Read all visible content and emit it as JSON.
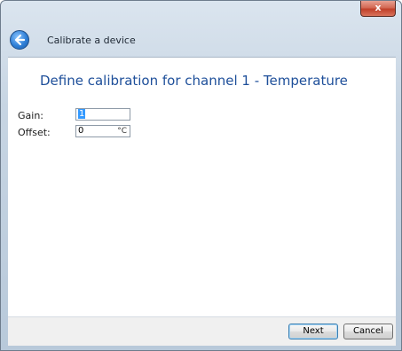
{
  "window": {
    "title": "Calibrate a device",
    "close_label": "x"
  },
  "main": {
    "heading": "Define calibration for channel 1 - Temperature",
    "fields": [
      {
        "label": "Gain:",
        "value": "1",
        "unit": ""
      },
      {
        "label": "Offset:",
        "value": "0",
        "unit": "°C"
      }
    ]
  },
  "footer": {
    "next_label": "Next",
    "cancel_label": "Cancel"
  }
}
